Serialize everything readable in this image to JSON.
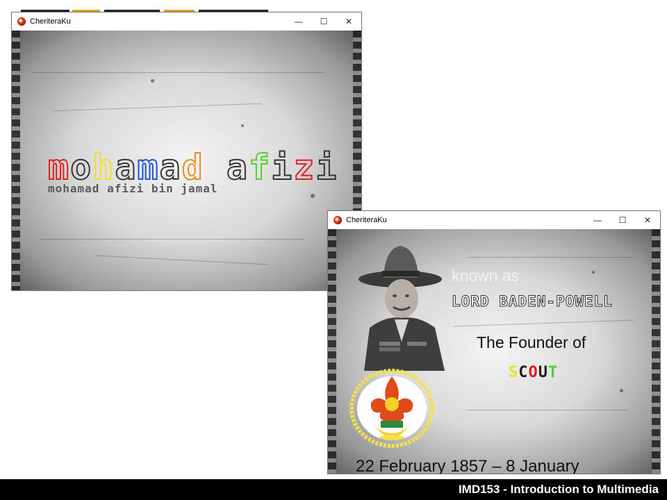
{
  "window1": {
    "title": "CheriteraKu",
    "controls": [
      "—",
      "☐",
      "✕"
    ],
    "heading_letters": [
      {
        "char": "m",
        "color": "#e02020"
      },
      {
        "char": "o",
        "color": "#333333"
      },
      {
        "char": "h",
        "color": "#f0e020"
      },
      {
        "char": "a",
        "color": "#333333"
      },
      {
        "char": "m",
        "color": "#2050e0"
      },
      {
        "char": "a",
        "color": "#333333"
      },
      {
        "char": "d",
        "color": "#f08a20"
      },
      {
        "char": " ",
        "color": "#333333"
      },
      {
        "char": "a",
        "color": "#333333"
      },
      {
        "char": "f",
        "color": "#50d030"
      },
      {
        "char": "i",
        "color": "#333333"
      },
      {
        "char": "z",
        "color": "#e02020"
      },
      {
        "char": "i",
        "color": "#333333"
      }
    ],
    "subtitle": "mohamad afizi bin jamal"
  },
  "window2": {
    "title": "CheriteraKu",
    "controls": [
      "—",
      "☐",
      "✕"
    ],
    "known_as": "known as",
    "lord": "LORD BADEN-POWELL",
    "founder": "The Founder of",
    "scout_letters": [
      {
        "char": "S",
        "color": "#f0e020"
      },
      {
        "char": "C",
        "color": "#222222"
      },
      {
        "char": "O",
        "color": "#e02020"
      },
      {
        "char": "U",
        "color": "#222222"
      },
      {
        "char": "T",
        "color": "#50d030"
      }
    ],
    "dates": "22 February 1857 – 8 January"
  },
  "footer": {
    "text": "IMD153 - Introduction to Multimedia"
  },
  "accent_colors": {
    "gold": "#d9a62a",
    "dark": "#222222"
  }
}
